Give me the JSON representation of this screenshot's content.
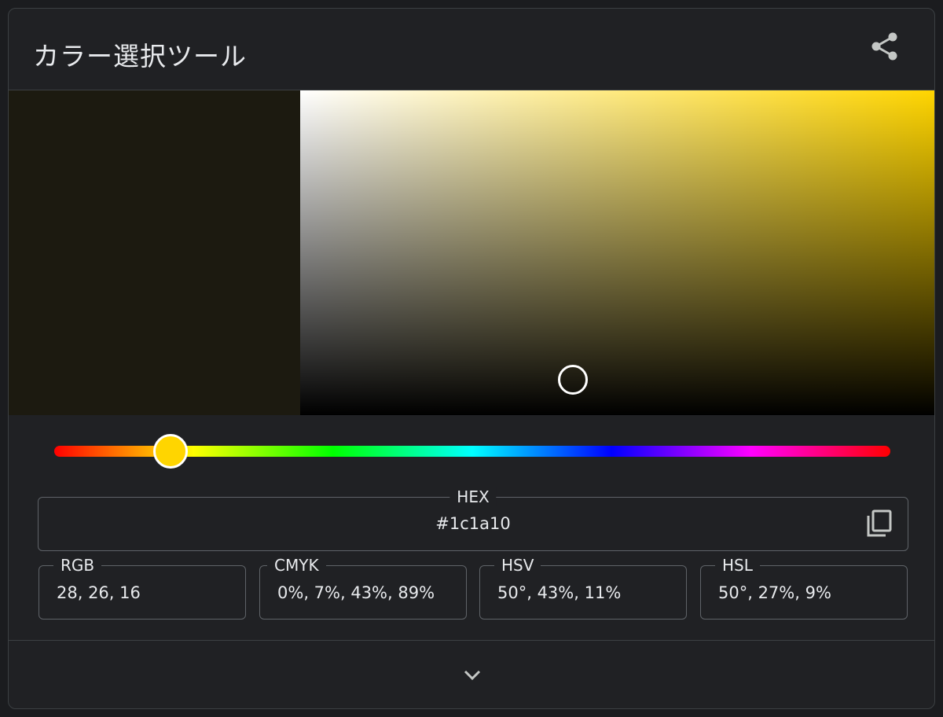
{
  "header": {
    "title": "カラー選択ツール",
    "share_icon": "share-icon"
  },
  "picker": {
    "selected_color": "#1c1a10",
    "hue_color": "#ffd500",
    "hue_degrees": 50,
    "saturation": 0.43,
    "value": 0.11
  },
  "hex": {
    "label": "HEX",
    "value": "#1c1a10",
    "copy_icon": "copy-icon"
  },
  "formats": {
    "rgb": {
      "label": "RGB",
      "value": "28, 26, 16"
    },
    "cmyk": {
      "label": "CMYK",
      "value": "0%, 7%, 43%, 89%"
    },
    "hsv": {
      "label": "HSV",
      "value": "50°, 43%, 11%"
    },
    "hsl": {
      "label": "HSL",
      "value": "50°, 27%, 9%"
    }
  },
  "footer": {
    "expand_icon": "chevron-down-icon"
  }
}
